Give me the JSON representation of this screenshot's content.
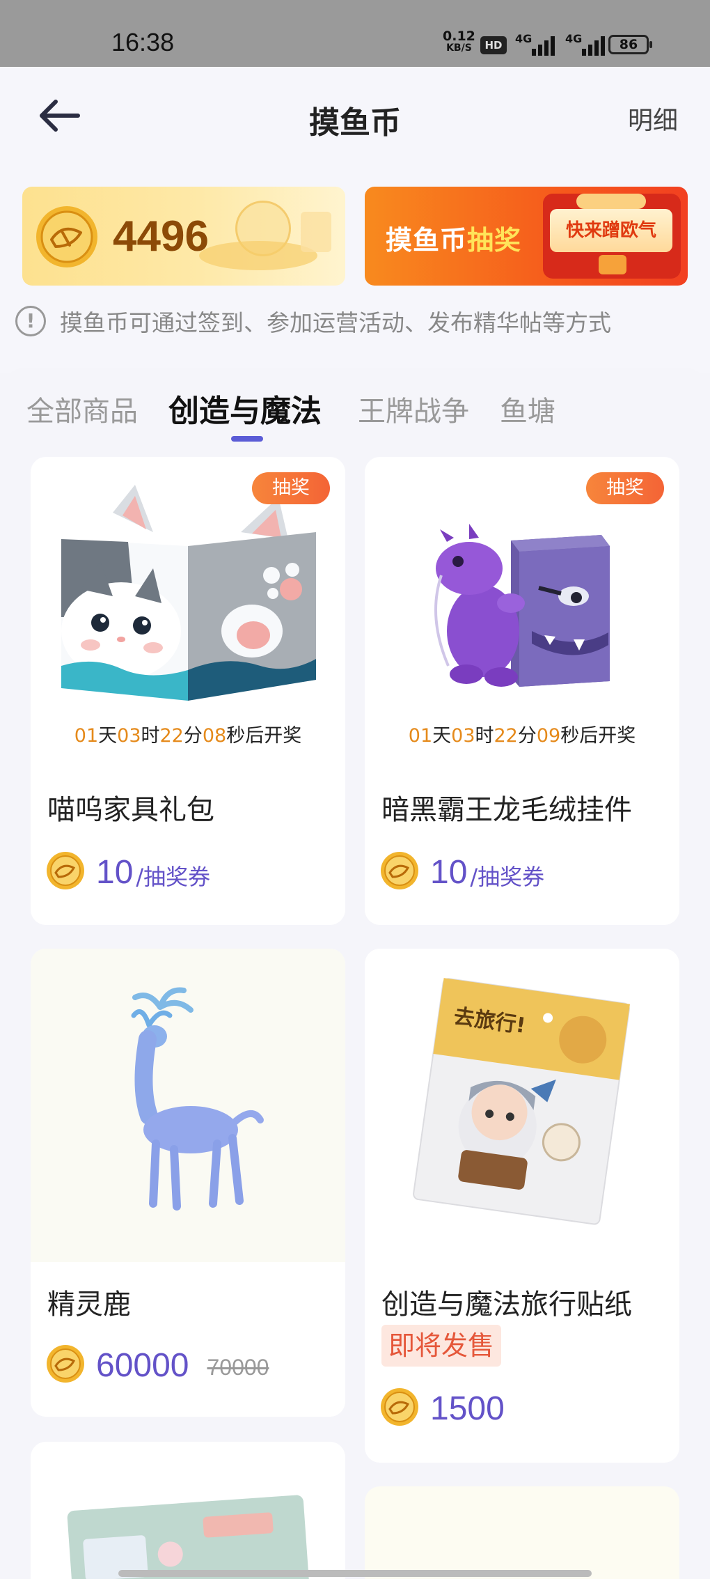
{
  "status_bar": {
    "time": "16:38",
    "net_speed_value": "0.12",
    "net_speed_unit": "KB/S",
    "hd_label": "HD",
    "sim1_label": "4G",
    "sim2_label": "4G",
    "battery": "86"
  },
  "header": {
    "title": "摸鱼币",
    "detail_label": "明细"
  },
  "coin_balance": {
    "amount": "4496"
  },
  "lottery_banner": {
    "text_main": "摸鱼币",
    "text_highlight": "抽奖",
    "button_label": "快来蹭欧气"
  },
  "notice": {
    "text": "摸鱼币可通过签到、参加运营活动、发布精华帖等方式"
  },
  "tabs": [
    {
      "label": "全部商品"
    },
    {
      "label": "创造与魔法"
    },
    {
      "label": "王牌战争"
    },
    {
      "label": "鱼塘"
    }
  ],
  "products": [
    {
      "badge": "抽奖",
      "countdown": {
        "days": "01",
        "d_unit": "天",
        "hours": "03",
        "h_unit": "时",
        "minutes": "22",
        "m_unit": "分",
        "seconds": "08",
        "s_suffix": "秒后开奖"
      },
      "name": "喵呜家具礼包",
      "price": "10",
      "unit": "/抽奖券"
    },
    {
      "badge": "抽奖",
      "countdown": {
        "days": "01",
        "d_unit": "天",
        "hours": "03",
        "h_unit": "时",
        "minutes": "22",
        "m_unit": "分",
        "seconds": "09",
        "s_suffix": "秒后开奖"
      },
      "name": "暗黑霸王龙毛绒挂件",
      "price": "10",
      "unit": "/抽奖券"
    },
    {
      "name": "精灵鹿",
      "price": "60000",
      "original_price": "70000"
    },
    {
      "name": "创造与魔法旅行贴纸",
      "status": "即将发售",
      "price": "1500",
      "sticker_title": "去旅行!"
    }
  ],
  "colors": {
    "accent": "#6352c8",
    "tab_indicator": "#5b5cd6",
    "badge": "#f46436",
    "countdown_number": "#e58a1b"
  },
  "icons": [
    "back-arrow-icon",
    "coin-icon",
    "info-icon",
    "signal-icon",
    "battery-icon"
  ]
}
